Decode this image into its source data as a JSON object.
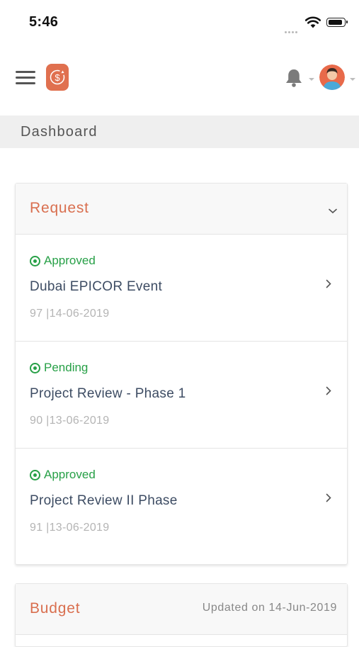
{
  "status_bar": {
    "time": "5:46"
  },
  "header": {
    "menu_icon": "hamburger-menu-icon",
    "logo_icon": "dollar-cycle-logo",
    "notification_icon": "bell-icon",
    "avatar_icon": "user-avatar"
  },
  "page": {
    "title": "Dashboard"
  },
  "request_card": {
    "title": "Request",
    "collapse_icon": "chevron-down-icon",
    "items": [
      {
        "status": "Approved",
        "name": "Dubai EPICOR Event",
        "meta": "97 |14-06-2019"
      },
      {
        "status": "Pending",
        "name": "Project Review - Phase 1",
        "meta": "90 |13-06-2019"
      },
      {
        "status": "Approved",
        "name": "Project Review II Phase",
        "meta": "91 |13-06-2019"
      }
    ]
  },
  "budget_card": {
    "title": "Budget",
    "updated": "Updated on 14-Jun-2019"
  },
  "colors": {
    "accent": "#d96f4f",
    "status_green": "#27a047",
    "text_primary": "#3d4c63",
    "text_muted": "#b4b4b4",
    "logo_bg": "#e0704f"
  }
}
